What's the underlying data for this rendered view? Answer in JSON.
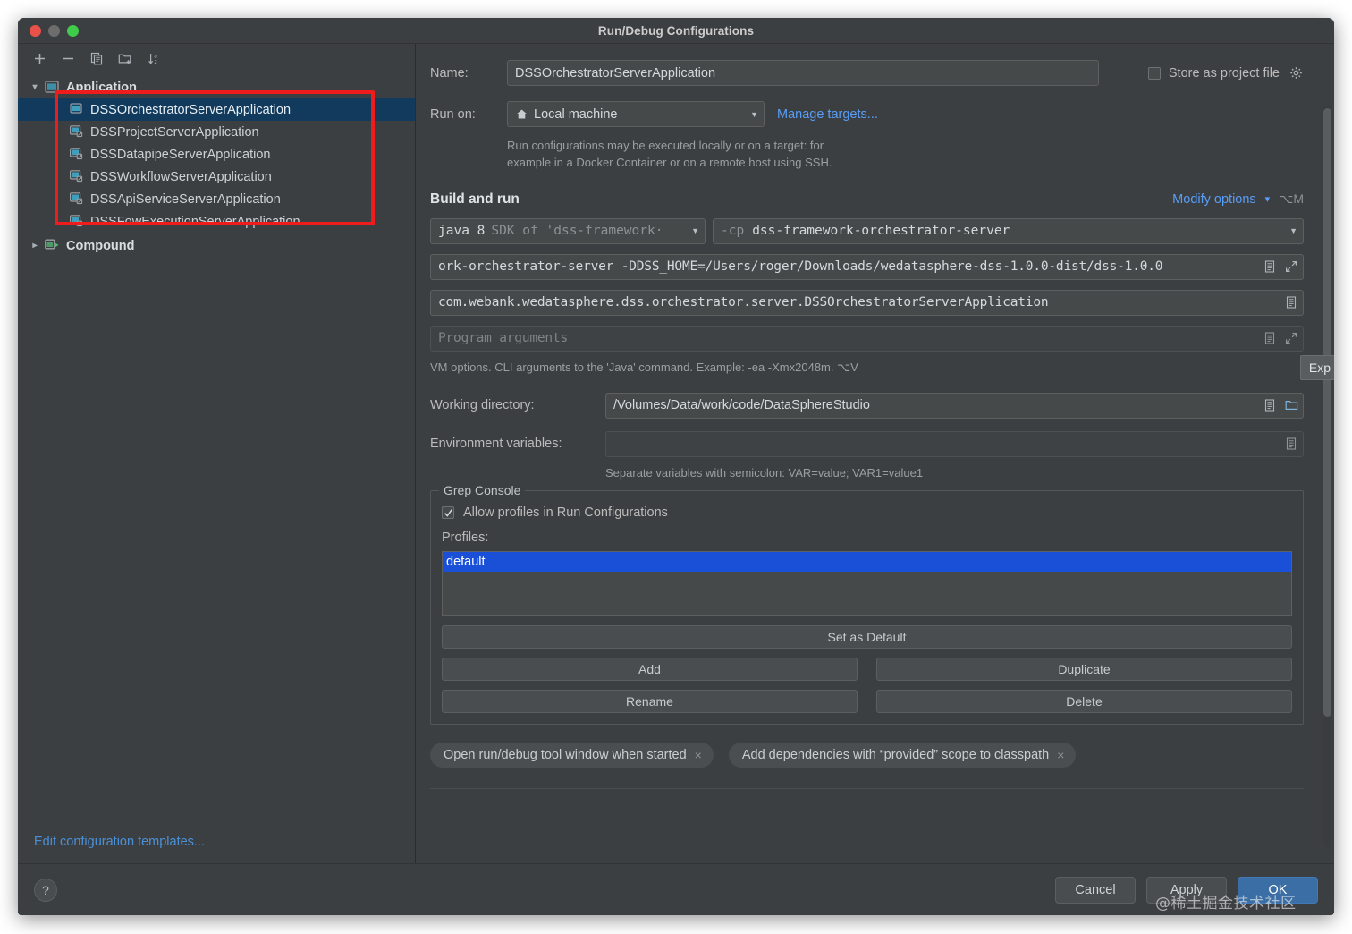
{
  "window": {
    "title": "Run/Debug Configurations",
    "traffic_lights": [
      "close",
      "minimize",
      "zoom"
    ]
  },
  "sidebar": {
    "toolbar": [
      {
        "name": "add-configuration-button",
        "glyph": "+"
      },
      {
        "name": "remove-configuration-button",
        "glyph": "−"
      },
      {
        "name": "copy-configuration-button",
        "glyph": "copy-icon"
      },
      {
        "name": "new-folder-button",
        "glyph": "folder-add-icon"
      },
      {
        "name": "sort-configurations-button",
        "glyph": "sort-az-icon"
      }
    ],
    "tree": [
      {
        "label": "Application",
        "type": "group",
        "expanded": true,
        "icon": "application-group-icon",
        "children": [
          {
            "label": "DSSOrchestratorServerApplication",
            "selected": true,
            "icon": "run-config-icon"
          },
          {
            "label": "DSSProjectServerApplication",
            "selected": false,
            "icon": "run-config-icon"
          },
          {
            "label": "DSSDatapipeServerApplication",
            "selected": false,
            "icon": "run-config-icon"
          },
          {
            "label": "DSSWorkflowServerApplication",
            "selected": false,
            "icon": "run-config-icon"
          },
          {
            "label": "DSSApiServiceServerApplication",
            "selected": false,
            "icon": "run-config-icon"
          },
          {
            "label": "DSSFowExecutionServerApplication",
            "selected": false,
            "icon": "run-config-icon"
          }
        ]
      },
      {
        "label": "Compound",
        "type": "group",
        "expanded": false,
        "icon": "compound-group-icon",
        "children": []
      }
    ],
    "edit_templates_link": "Edit configuration templates..."
  },
  "form": {
    "name_label": "Name:",
    "name_value": "DSSOrchestratorServerApplication",
    "store_as_project_file_label": "Store as project file",
    "store_as_project_file_checked": false,
    "run_on_label": "Run on:",
    "run_on_value": "Local machine",
    "manage_targets_link": "Manage targets...",
    "run_on_hint_line1": "Run configurations may be executed locally or on a target: for",
    "run_on_hint_line2": "example in a Docker Container or on a remote host using SSH.",
    "build_and_run_title": "Build and run",
    "modify_options_link": "Modify options",
    "modify_options_shortcut": "⌥M",
    "jre_combo_main": "java 8",
    "jre_combo_sub": "SDK of 'dss-framework·",
    "cp_prefix": "-cp",
    "cp_module": "dss-framework-orchestrator-server",
    "vm_options_value": "ork-orchestrator-server -DDSS_HOME=/Users/roger/Downloads/wedatasphere-dss-1.0.0-dist/dss-1.0.0",
    "main_class_value": "com.webank.wedatasphere.dss.orchestrator.server.DSSOrchestratorServerApplication",
    "program_arguments_placeholder": "Program arguments",
    "vm_hint": "VM options. CLI arguments to the 'Java' command. Example: -ea -Xmx2048m. ⌥V",
    "working_directory_label": "Working directory:",
    "working_directory_value": "/Volumes/Data/work/code/DataSphereStudio",
    "environment_variables_label": "Environment variables:",
    "environment_variables_value": "",
    "environment_variables_hint": "Separate variables with semicolon: VAR=value; VAR1=value1",
    "expand_tooltip": "Exp"
  },
  "grep_console": {
    "legend": "Grep Console",
    "allow_profiles_label": "Allow profiles in Run Configurations",
    "allow_profiles_checked": true,
    "profiles_label": "Profiles:",
    "profiles": [
      "default"
    ],
    "selected_profile": "default",
    "buttons": {
      "set_as_default": "Set as Default",
      "add": "Add",
      "duplicate": "Duplicate",
      "rename": "Rename",
      "delete": "Delete"
    }
  },
  "chips": [
    {
      "label": "Open run/debug tool window when started",
      "close": "×"
    },
    {
      "label": "Add dependencies with “provided” scope to classpath",
      "close": "×"
    }
  ],
  "footer": {
    "help_glyph": "?",
    "cancel": "Cancel",
    "apply": "Apply",
    "ok": "OK"
  },
  "overlay": {
    "watermark": "@稀土掘金技术社区"
  },
  "colors": {
    "window_bg": "#3c3f41",
    "selection_blue": "#113a5c",
    "list_selection": "#1a4fd8",
    "link_blue": "#589df6",
    "annotation_red": "#ee1c1c",
    "primary_button": "#3b6ea5"
  }
}
